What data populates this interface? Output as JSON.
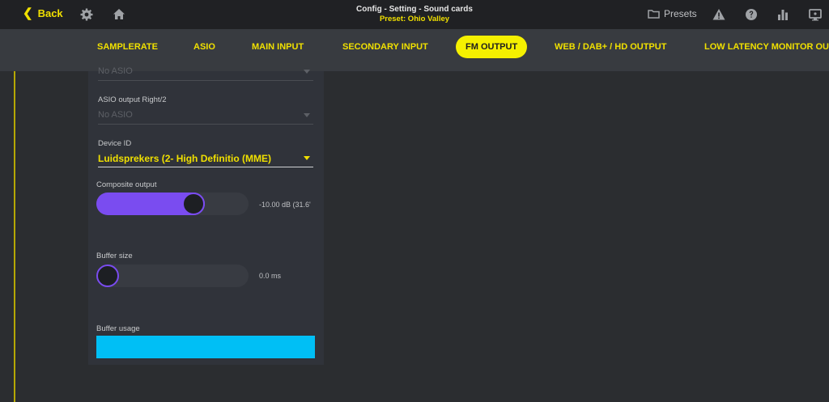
{
  "topbar": {
    "back_label": "Back",
    "title": "Config - Setting - Sound cards",
    "preset": "Preset: Ohio Valley",
    "presets_label": "Presets",
    "icons": [
      "gear-icon",
      "home-icon",
      "folder-icon",
      "warning-icon",
      "help-icon",
      "chart-icon",
      "monitor-icon"
    ]
  },
  "tabs": [
    {
      "label": "SAMPLERATE",
      "active": false
    },
    {
      "label": "ASIO",
      "active": false
    },
    {
      "label": "MAIN INPUT",
      "active": false
    },
    {
      "label": "SECONDARY INPUT",
      "active": false
    },
    {
      "label": "FM OUTPUT",
      "active": true
    },
    {
      "label": "WEB / DAB+ / HD OUTPUT",
      "active": false
    },
    {
      "label": "LOW LATENCY MONITOR OU",
      "active": false
    }
  ],
  "panel": {
    "asio_left_value": "No ASIO",
    "asio_right_label": "ASIO output Right/2",
    "asio_right_value": "No ASIO",
    "device_label": "Device ID",
    "device_value": "Luidsprekers (2- High Definitio (MME)",
    "composite_label": "Composite output",
    "composite_value": "-10.00 dB (31.6'",
    "composite_fraction": 0.66,
    "buffer_size_label": "Buffer size",
    "buffer_size_value": "0.0 ms",
    "buffer_size_fraction": 0.0,
    "buffer_usage_label": "Buffer usage"
  },
  "colors": {
    "accent_yellow": "#f0e000",
    "slider_purple": "#7a4cf0",
    "usage_cyan": "#00bff5"
  }
}
